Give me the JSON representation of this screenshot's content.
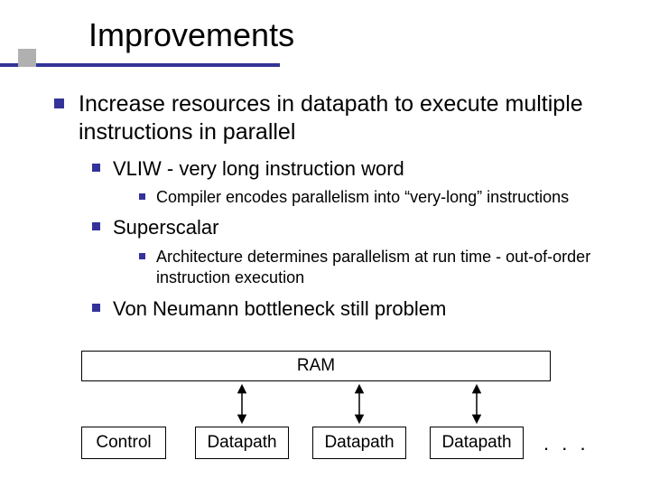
{
  "title": "Improvements",
  "l1_text": "Increase resources in datapath to execute multiple instructions in parallel",
  "items": {
    "vliw": {
      "label": "VLIW - very long instruction word",
      "sub": "Compiler encodes parallelism into “very-long” instructions"
    },
    "superscalar": {
      "label": "Superscalar",
      "sub": "Architecture determines parallelism at run time - out-of-order instruction execution"
    },
    "vn": {
      "label": "Von Neumann bottleneck still problem"
    }
  },
  "diagram": {
    "ram": "RAM",
    "control": "Control",
    "datapath": "Datapath",
    "dots": ". . ."
  }
}
